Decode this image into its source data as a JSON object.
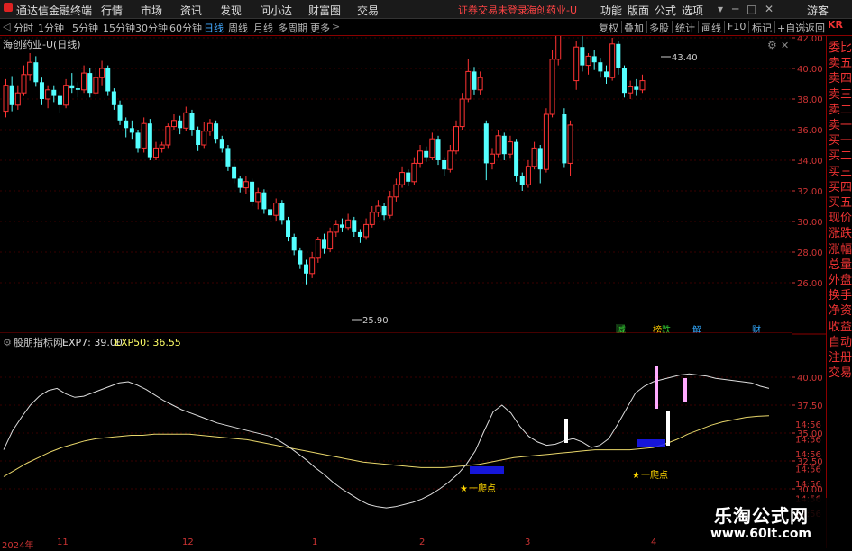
{
  "titlebar": {
    "app_title": "通达信金融终端",
    "menu": [
      "行情",
      "市场",
      "资讯",
      "发现",
      "问小达",
      "财富圈",
      "交易"
    ],
    "notice": "证券交易未登录",
    "stock": "海创药业-U",
    "right_menu": [
      "功能",
      "版面",
      "公式",
      "选项"
    ],
    "user": "游客"
  },
  "toolbar": {
    "periods": [
      "分时",
      "1分钟",
      "5分钟",
      "15分钟",
      "30分钟",
      "60分钟",
      "日线",
      "周线",
      "月线",
      "多周期",
      "更多"
    ],
    "active_period": "日线",
    "right_tools": [
      "复权",
      "叠加",
      "多股",
      "统计",
      "画线",
      "F10",
      "标记",
      "+自选",
      "返回"
    ]
  },
  "main_chart": {
    "title": "海创药业-U(日线)",
    "high_label": "43.40",
    "low_label": "25.90",
    "events": [
      {
        "text": "减",
        "color": "#33cc33"
      },
      {
        "text": "榜",
        "color": "#ffcc00"
      },
      {
        "text": "跌",
        "color": "#33cc33"
      },
      {
        "text": "解",
        "color": "#33aaff"
      },
      {
        "text": "财",
        "color": "#33aaff"
      }
    ],
    "y_ticks": [
      "42.00",
      "40.00",
      "38.00",
      "36.00",
      "34.00",
      "32.00",
      "30.00",
      "28.00",
      "26.00"
    ]
  },
  "sub_chart": {
    "title": "股朋指标网",
    "exp7_label": "EXP7: 39.00",
    "exp50_label": "EXP50: 36.55",
    "y_ticks": [
      "40.00",
      "37.50",
      "35.00",
      "32.50",
      "30.00"
    ],
    "signals": [
      "一爬点",
      "一爬点"
    ]
  },
  "sidebar": {
    "items": [
      "委比",
      "卖五",
      "卖四",
      "卖三",
      "卖二",
      "卖一",
      "买一",
      "买二",
      "买三",
      "买四",
      "买五",
      "现价",
      "涨跌",
      "涨幅",
      "总量",
      "外盘",
      "换手",
      "净资",
      "收益",
      "自动",
      "注册",
      "交易"
    ],
    "times": [
      "14:56",
      "14:56",
      "14:56",
      "14:56",
      "14:56",
      "14:56",
      "14:56"
    ]
  },
  "date_axis": {
    "labels": [
      "2024年",
      "11",
      "12",
      "1",
      "2",
      "3",
      "4"
    ]
  },
  "watermark": {
    "title": "乐淘公式网",
    "url": "www.60lt.com"
  },
  "chart_data": {
    "type": "candlestick",
    "title": "海创药业-U(日线)",
    "ylim": [
      25,
      44
    ],
    "candles": [
      [
        37.2,
        38.9,
        39.3,
        36.8
      ],
      [
        38.9,
        37.6,
        39.5,
        37.2
      ],
      [
        37.6,
        38.4,
        38.9,
        37.3
      ],
      [
        38.4,
        39.6,
        40.2,
        38.2
      ],
      [
        39.6,
        40.4,
        41.0,
        39.2
      ],
      [
        40.4,
        39.1,
        40.8,
        38.8
      ],
      [
        39.1,
        38.0,
        39.4,
        37.6
      ],
      [
        38.0,
        38.6,
        38.9,
        37.4
      ],
      [
        38.6,
        38.2,
        38.9,
        37.8
      ],
      [
        38.2,
        37.6,
        38.5,
        37.1
      ],
      [
        37.6,
        38.9,
        39.3,
        37.4
      ],
      [
        38.9,
        38.7,
        39.7,
        38.4
      ],
      [
        38.7,
        38.6,
        39.1,
        38.1
      ],
      [
        38.6,
        39.7,
        40.2,
        38.4
      ],
      [
        39.7,
        38.4,
        40.0,
        38.1
      ],
      [
        38.4,
        39.4,
        40.0,
        38.2
      ],
      [
        39.4,
        40.0,
        40.5,
        38.9
      ],
      [
        40.0,
        38.5,
        40.2,
        38.2
      ],
      [
        38.5,
        37.6,
        38.7,
        37.3
      ],
      [
        37.6,
        36.6,
        37.9,
        36.3
      ],
      [
        36.6,
        36.1,
        36.8,
        35.5
      ],
      [
        36.1,
        35.8,
        36.6,
        35.4
      ],
      [
        35.8,
        34.8,
        36.0,
        34.5
      ],
      [
        34.8,
        36.4,
        36.8,
        34.5
      ],
      [
        36.4,
        34.2,
        36.7,
        34.0
      ],
      [
        34.2,
        34.8,
        35.2,
        34.0
      ],
      [
        34.8,
        35.0,
        35.2,
        34.5
      ],
      [
        35.0,
        36.2,
        36.4,
        34.8
      ],
      [
        36.2,
        36.6,
        37.0,
        36.0
      ],
      [
        36.6,
        36.1,
        36.9,
        35.7
      ],
      [
        36.1,
        37.1,
        37.5,
        35.9
      ],
      [
        37.1,
        36.0,
        37.3,
        35.6
      ],
      [
        36.0,
        35.0,
        36.2,
        34.6
      ],
      [
        35.0,
        35.9,
        36.5,
        34.8
      ],
      [
        35.9,
        36.4,
        36.7,
        35.6
      ],
      [
        36.4,
        35.4,
        36.6,
        35.1
      ],
      [
        35.4,
        34.8,
        35.6,
        34.5
      ],
      [
        34.8,
        33.6,
        35.0,
        33.3
      ],
      [
        33.6,
        32.8,
        33.8,
        32.5
      ],
      [
        32.8,
        32.2,
        33.0,
        31.9
      ],
      [
        32.2,
        32.6,
        33.0,
        31.8
      ],
      [
        32.6,
        31.3,
        32.8,
        31.0
      ],
      [
        31.3,
        31.9,
        32.2,
        30.8
      ],
      [
        31.9,
        30.8,
        32.1,
        30.5
      ],
      [
        30.8,
        30.4,
        31.1,
        30.1
      ],
      [
        30.4,
        31.2,
        31.5,
        30.0
      ],
      [
        31.2,
        30.1,
        31.4,
        29.8
      ],
      [
        30.1,
        29.0,
        30.3,
        28.7
      ],
      [
        29.0,
        28.1,
        29.2,
        27.8
      ],
      [
        28.1,
        27.2,
        28.3,
        26.9
      ],
      [
        27.2,
        26.6,
        27.5,
        25.9
      ],
      [
        26.6,
        27.6,
        28.0,
        26.3
      ],
      [
        27.6,
        28.8,
        29.0,
        27.3
      ],
      [
        28.8,
        28.2,
        29.2,
        27.9
      ],
      [
        28.2,
        29.3,
        29.6,
        28.0
      ],
      [
        29.3,
        29.8,
        30.1,
        29.0
      ],
      [
        29.8,
        29.6,
        30.2,
        29.3
      ],
      [
        29.6,
        30.1,
        30.5,
        29.4
      ],
      [
        30.1,
        29.3,
        30.3,
        29.0
      ],
      [
        29.3,
        29.0,
        29.5,
        28.6
      ],
      [
        29.0,
        29.8,
        30.2,
        28.8
      ],
      [
        29.8,
        30.6,
        31.0,
        29.6
      ],
      [
        30.6,
        31.0,
        31.4,
        30.3
      ],
      [
        31.0,
        30.4,
        31.2,
        30.1
      ],
      [
        30.4,
        31.6,
        32.0,
        30.2
      ],
      [
        31.6,
        32.4,
        32.8,
        31.3
      ],
      [
        32.4,
        33.2,
        33.6,
        32.2
      ],
      [
        33.2,
        32.6,
        33.4,
        32.3
      ],
      [
        32.6,
        33.8,
        34.2,
        32.4
      ],
      [
        33.8,
        34.6,
        35.0,
        33.5
      ],
      [
        34.6,
        34.2,
        34.9,
        33.9
      ],
      [
        34.2,
        35.4,
        35.8,
        34.0
      ],
      [
        35.4,
        34.0,
        35.6,
        33.7
      ],
      [
        34.0,
        33.4,
        34.2,
        33.0
      ],
      [
        33.4,
        34.6,
        35.0,
        33.2
      ],
      [
        34.6,
        36.2,
        36.6,
        34.4
      ],
      [
        36.2,
        38.0,
        38.4,
        36.0
      ],
      [
        38.0,
        39.8,
        40.6,
        37.8
      ],
      [
        39.8,
        38.6,
        40.1,
        38.3
      ],
      [
        38.6,
        39.4,
        39.8,
        38.3
      ],
      [
        36.4,
        33.8,
        36.6,
        32.7
      ],
      [
        33.8,
        34.4,
        34.8,
        33.4
      ],
      [
        34.4,
        35.6,
        36.0,
        34.2
      ],
      [
        35.6,
        34.4,
        35.8,
        34.0
      ],
      [
        34.4,
        35.2,
        35.6,
        34.1
      ],
      [
        35.2,
        33.0,
        35.4,
        32.6
      ],
      [
        33.0,
        32.4,
        33.2,
        32.0
      ],
      [
        32.4,
        33.6,
        34.0,
        32.2
      ],
      [
        33.6,
        34.8,
        35.2,
        33.4
      ],
      [
        34.8,
        33.4,
        35.0,
        32.5
      ],
      [
        33.4,
        37.0,
        37.4,
        33.2
      ],
      [
        37.0,
        40.6,
        41.2,
        36.8
      ],
      [
        40.6,
        43.0,
        43.4,
        40.2
      ],
      [
        37.0,
        33.8,
        37.4,
        33.5
      ],
      [
        33.8,
        36.3,
        36.6,
        33.0
      ],
      [
        39.2,
        41.4,
        41.8,
        38.6
      ],
      [
        41.4,
        40.2,
        42.2,
        39.8
      ],
      [
        40.2,
        40.8,
        41.0,
        39.6
      ],
      [
        40.8,
        40.4,
        41.2,
        39.9
      ],
      [
        40.4,
        39.8,
        40.7,
        39.4
      ],
      [
        39.8,
        39.4,
        40.2,
        39.0
      ],
      [
        39.4,
        41.6,
        42.0,
        39.2
      ],
      [
        41.6,
        40.0,
        41.8,
        39.6
      ],
      [
        40.0,
        38.4,
        40.2,
        38.1
      ],
      [
        38.4,
        38.8,
        39.2,
        38.0
      ],
      [
        38.8,
        38.6,
        39.3,
        38.2
      ],
      [
        38.6,
        39.2,
        39.6,
        38.4
      ]
    ],
    "series": [
      {
        "name": "EXP7",
        "values": [
          33.5,
          35.2,
          36.4,
          37.5,
          38.3,
          38.8,
          39.0,
          38.5,
          38.2,
          38.3,
          38.6,
          38.9,
          39.2,
          39.5,
          39.6,
          39.3,
          38.9,
          38.4,
          37.9,
          37.5,
          37.1,
          36.8,
          36.5,
          36.2,
          35.9,
          35.7,
          35.5,
          35.3,
          35.1,
          34.9,
          34.7,
          34.3,
          33.8,
          33.2,
          32.6,
          31.9,
          31.3,
          30.6,
          30.0,
          29.5,
          29.0,
          28.6,
          28.4,
          28.3,
          28.4,
          28.6,
          28.8,
          29.1,
          29.5,
          30.0,
          30.6,
          31.3,
          32.2,
          33.4,
          35.2,
          36.9,
          37.5,
          36.8,
          35.6,
          34.7,
          34.2,
          33.9,
          34.0,
          34.3,
          34.5,
          34.2,
          33.7,
          33.9,
          34.5,
          35.8,
          37.2,
          38.6,
          39.2,
          39.6,
          39.8,
          40.0,
          40.2,
          40.3,
          40.2,
          40.1,
          39.9,
          39.8,
          39.7,
          39.6,
          39.5,
          39.2,
          39.0
        ]
      },
      {
        "name": "EXP50",
        "values": [
          31.1,
          31.7,
          32.3,
          32.8,
          33.3,
          33.7,
          34.0,
          34.3,
          34.5,
          34.6,
          34.7,
          34.8,
          34.8,
          34.9,
          34.9,
          34.9,
          34.9,
          34.8,
          34.7,
          34.6,
          34.5,
          34.4,
          34.2,
          34.0,
          33.8,
          33.6,
          33.4,
          33.2,
          33.0,
          32.8,
          32.6,
          32.4,
          32.3,
          32.2,
          32.1,
          32.0,
          31.9,
          31.9,
          31.9,
          32.0,
          32.1,
          32.2,
          32.4,
          32.6,
          32.8,
          32.9,
          33.0,
          33.1,
          33.2,
          33.3,
          33.4,
          33.5,
          33.5,
          33.5,
          33.5,
          33.6,
          33.7,
          34.0,
          34.4,
          34.9,
          35.3,
          35.7,
          36.0,
          36.2,
          36.4,
          36.5,
          36.55
        ]
      }
    ]
  }
}
